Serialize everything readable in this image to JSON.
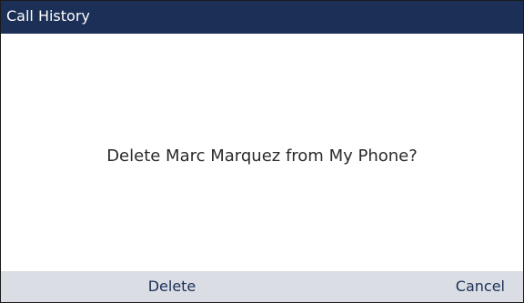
{
  "window": {
    "title": "Call History"
  },
  "dialog": {
    "message": "Delete Marc Marquez from My Phone?"
  },
  "softkeys": {
    "delete_label": "Delete",
    "cancel_label": "Cancel"
  },
  "colors": {
    "title_bar": "#1b2f57",
    "softkey_bar": "#dadde3",
    "softkey_text": "#1b2f57"
  }
}
